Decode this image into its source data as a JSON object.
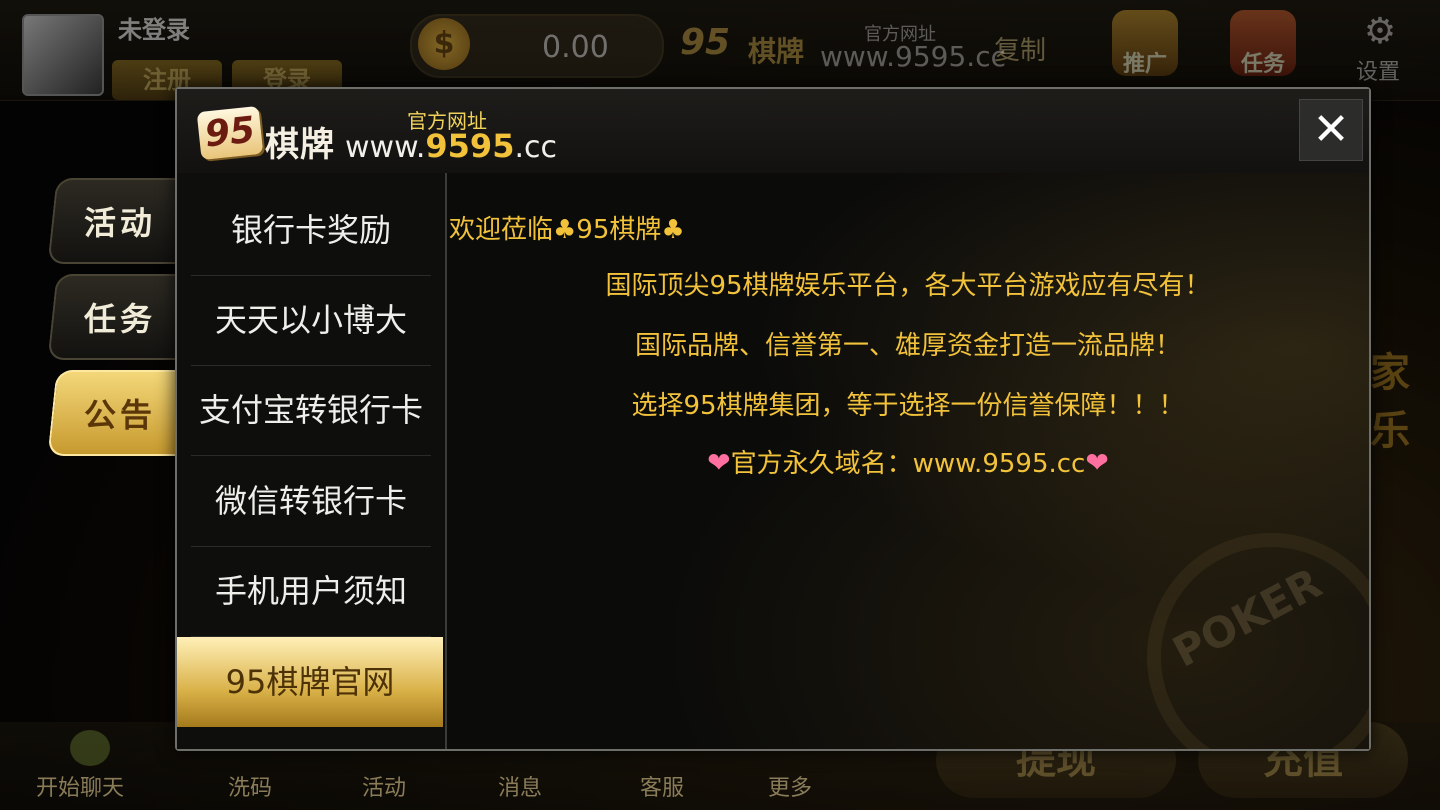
{
  "background": {
    "username": "未登录",
    "register_label": "注册",
    "login_label": "登录",
    "balance": "0.00",
    "brand_logo_num": "95",
    "brand_logo_cn": "棋牌",
    "site_label": "官方网址",
    "site_url": "www.9595.cc",
    "copy_label": "复制",
    "promote_label": "推广",
    "task_label": "任务",
    "settings_label": "设置",
    "right_deco": "家乐",
    "bottom_nav": [
      "开始聊天",
      "洗码",
      "活动",
      "消息",
      "客服",
      "更多"
    ],
    "withdraw_label": "提现",
    "recharge_label": "充值"
  },
  "side_tabs": [
    {
      "label": "活动",
      "active": false
    },
    {
      "label": "任务",
      "active": false
    },
    {
      "label": "公告",
      "active": true
    }
  ],
  "dialog": {
    "logo_num": "95",
    "logo_cn": "棋牌",
    "site_label": "官方网址",
    "site_prefix": "www.",
    "site_num": "9595",
    "site_suffix": ".cc",
    "close_glyph": "✕",
    "menu": [
      {
        "label": "银行卡奖励",
        "active": false
      },
      {
        "label": "天天以小博大",
        "active": false
      },
      {
        "label": "支付宝转银行卡",
        "active": false
      },
      {
        "label": "微信转银行卡",
        "active": false
      },
      {
        "label": "手机用户须知",
        "active": false
      },
      {
        "label": "95棋牌官网",
        "active": true
      }
    ],
    "content": {
      "welcome": "欢迎莅临♣95棋牌♣",
      "lines": [
        "国际顶尖95棋牌娱乐平台，各大平台游戏应有尽有！",
        "国际品牌、信誉第一、雄厚资金打造一流品牌！",
        "选择95棋牌集团，等于选择一份信誉保障！！！"
      ],
      "domain_text": "官方永久域名：www.9595.cc",
      "heart": "❤",
      "watermark": "POKER"
    }
  },
  "colors": {
    "accent_gold": "#f2c23a",
    "active_tab": "#e6c15a",
    "heart": "#ff6fa0"
  }
}
